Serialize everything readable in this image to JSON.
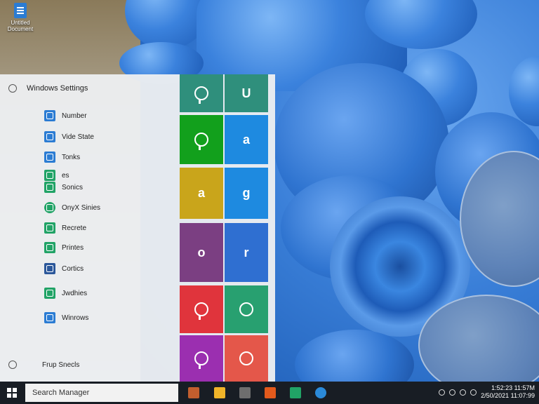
{
  "desktop": {
    "icon_label": "Untitled Document"
  },
  "start_menu": {
    "header": "Windows Settings",
    "apps": [
      {
        "label": "Number",
        "color": "#2b7cd3"
      },
      {
        "label": "Vide State",
        "color": "#2b7cd3"
      },
      {
        "label": "Tonks",
        "color": "#2b7cd3"
      },
      {
        "label": "es",
        "color": "#21a366"
      },
      {
        "label": "Sonics",
        "color": "#21a366"
      },
      {
        "label": "OnyX Sinies",
        "color": "#21a366"
      },
      {
        "label": "Recrete",
        "color": "#21a366"
      },
      {
        "label": "Printes",
        "color": "#21a366"
      },
      {
        "label": "Cortics",
        "color": "#2b579a"
      },
      {
        "label": "Jwdhies",
        "color": "#21a366"
      },
      {
        "label": "Winrows",
        "color": "#2b7cd3"
      }
    ],
    "footer": "Frup Snecls",
    "tiles": [
      {
        "glyph": "o",
        "color": "#2f8f7c"
      },
      {
        "glyph": "U",
        "color": "#2f8f7c"
      },
      {
        "glyph": "o",
        "color": "#12a01c"
      },
      {
        "glyph": "a",
        "color": "#1e8ae0"
      },
      {
        "glyph": "a",
        "color": "#c9a51b"
      },
      {
        "glyph": "g",
        "color": "#1e8ae0"
      },
      {
        "glyph": "o",
        "color": "#7b3f82"
      },
      {
        "glyph": "r",
        "color": "#2f6fd1"
      },
      {
        "glyph": "o",
        "color": "#e0343c"
      },
      {
        "glyph": "o",
        "color": "#28a070"
      },
      {
        "glyph": "o",
        "color": "#9b2fb0"
      },
      {
        "glyph": "o",
        "color": "#e4574a"
      }
    ]
  },
  "taskbar": {
    "search_text": "Search Manager",
    "apps": [
      {
        "name": "file-explorer-icon",
        "color": "#c25e2e"
      },
      {
        "name": "folder-icon",
        "color": "#f0b429"
      },
      {
        "name": "store-icon",
        "color": "#6e6e6e"
      },
      {
        "name": "office-icon",
        "color": "#e35a1c"
      },
      {
        "name": "excel-icon",
        "color": "#21a366"
      },
      {
        "name": "edge-icon",
        "color": "#2b8ad9"
      }
    ],
    "time": "1:52:23 11:57M",
    "date": "2/50/2021 11:07:99"
  }
}
